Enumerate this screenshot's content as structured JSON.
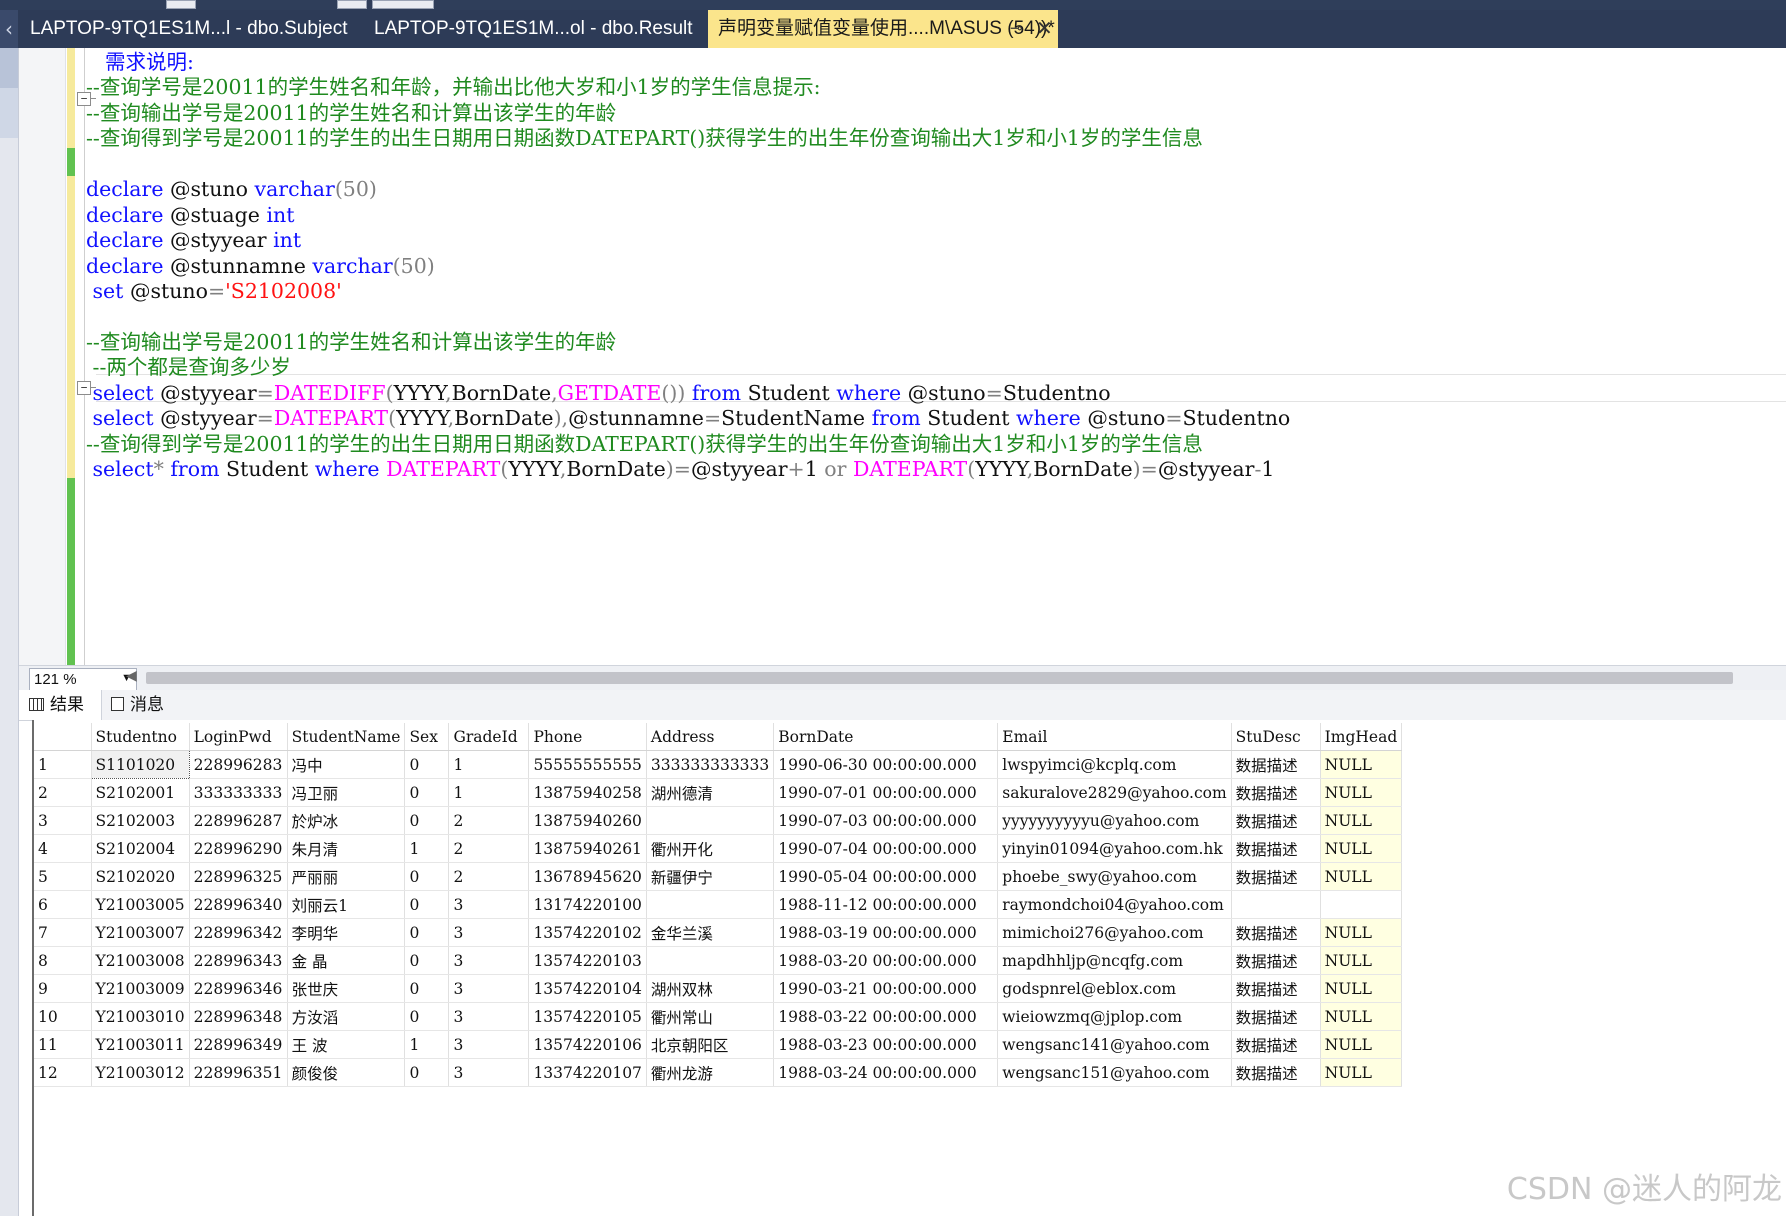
{
  "tabs": [
    {
      "label": "LAPTOP-9TQ1ES1M...l - dbo.Subject"
    },
    {
      "label": "LAPTOP-9TQ1ES1M...ol - dbo.Result"
    },
    {
      "label": "声明变量赋值变量使用....M\\ASUS (54))*",
      "active": true
    }
  ],
  "tab_icons": {
    "pin": "pin-icon",
    "close": "close-icon"
  },
  "editor": {
    "lines": {
      "l1": "需求说明:",
      "l2": "--查询学号是20011的学生姓名和年龄，并输出比他大岁和小1岁的学生信息提示:",
      "l3": "--查询输出学号是20011的学生姓名和计算出该学生的年龄",
      "l4": "--查询得到学号是20011的学生的出生日期用日期函数DATEPART()获得学生的出生年份查询输出大1岁和小1岁的学生信息",
      "l6a": "declare",
      "l6b": " @stuno ",
      "l6c": "varchar",
      "l6d": "(50)",
      "l7a": "declare",
      "l7b": " @stuage ",
      "l7c": "int",
      "l8a": "declare",
      "l8b": " @styyear ",
      "l8c": "int",
      "l9a": "declare",
      "l9b": " @stunnamne ",
      "l9c": "varchar",
      "l9d": "(50)",
      "l10a": " set",
      "l10b": " @stuno",
      "l10c": "=",
      "l10d": "'S2102008'",
      "l12": "--查询输出学号是20011的学生姓名和计算出该学生的年龄",
      "l13": " --两个都是查询多少岁",
      "l14a": " select",
      "l14b": " @styyear",
      "l14c": "=",
      "l14d": "DATEDIFF",
      "l14e": "(",
      "l14f": "YYYY",
      "l14g": ",",
      "l14h": "BornDate",
      "l14i": ",",
      "l14j": "GETDATE",
      "l14k": "())",
      "l14l": " from",
      "l14m": " Student ",
      "l14n": "where",
      "l14o": " @stuno",
      "l14p": "=",
      "l14q": "Studentno",
      "l15a": " select",
      "l15b": " @styyear",
      "l15c": "=",
      "l15d": "DATEPART",
      "l15e": "(",
      "l15f": "YYYY",
      "l15g": ",",
      "l15h": "BornDate",
      "l15i": "),",
      "l15j": "@stunnamne",
      "l15k": "=",
      "l15l": "StudentName ",
      "l15m": "from",
      "l15n": " Student ",
      "l15o": "where",
      "l15p": " @stuno",
      "l15q": "=",
      "l15r": "Studentno",
      "l16": "--查询得到学号是20011的学生的出生日期用日期函数DATEPART()获得学生的出生年份查询输出大1岁和小1岁的学生信息",
      "l17a": " select",
      "l17b": "*",
      "l17c": " from",
      "l17d": " Student ",
      "l17e": "where",
      "l17f": " DATEPART",
      "l17g": "(",
      "l17h": "YYYY",
      "l17i": ",",
      "l17j": "BornDate",
      "l17k": ")=",
      "l17l": "@styyear",
      "l17m": "+",
      "l17n": "1 ",
      "l17o": "or",
      "l17p": " DATEPART",
      "l17q": "(",
      "l17r": "YYYY",
      "l17s": ",",
      "l17t": "BornDate",
      "l17u": ")=",
      "l17v": "@styyear",
      "l17w": "-",
      "l17x": "1"
    }
  },
  "zoom": {
    "value": "121 %"
  },
  "results_tabs": [
    {
      "label": "结果"
    },
    {
      "label": "消息"
    }
  ],
  "grid": {
    "columns": [
      "Studentno",
      "LoginPwd",
      "StudentName",
      "Sex",
      "GradeId",
      "Phone",
      "Address",
      "BornDate",
      "Email",
      "StuDesc",
      "ImgHead"
    ],
    "rows": [
      [
        "1",
        "S1101020",
        "228996283",
        "冯中",
        "0",
        "1",
        "55555555555",
        "333333333333",
        "1990-06-30 00:00:00.000",
        "lwspyimci@kcplq.com",
        "数据描述",
        "NULL"
      ],
      [
        "2",
        "S2102001",
        "333333333",
        "冯卫丽",
        "0",
        "1",
        "13875940258",
        "湖州德清",
        "1990-07-01 00:00:00.000",
        "sakuralove2829@yahoo.com",
        "数据描述",
        "NULL"
      ],
      [
        "3",
        "S2102003",
        "228996287",
        "於炉冰",
        "0",
        "2",
        "13875940260",
        "",
        "1990-07-03 00:00:00.000",
        "yyyyyyyyyyu@yahoo.com",
        "数据描述",
        "NULL"
      ],
      [
        "4",
        "S2102004",
        "228996290",
        "朱月清",
        "1",
        "2",
        "13875940261",
        "衢州开化",
        "1990-07-04 00:00:00.000",
        "yinyin01094@yahoo.com.hk",
        "数据描述",
        "NULL"
      ],
      [
        "5",
        "S2102020",
        "228996325",
        "严丽丽",
        "0",
        "2",
        "13678945620",
        "新疆伊宁",
        "1990-05-04 00:00:00.000",
        "phoebe_swy@yahoo.com",
        "数据描述",
        "NULL"
      ],
      [
        "6",
        "Y21003005",
        "228996340",
        "刘丽云1",
        "0",
        "3",
        "13174220100",
        "",
        "1988-11-12 00:00:00.000",
        "raymondchoi04@yahoo.com",
        "",
        ""
      ],
      [
        "7",
        "Y21003007",
        "228996342",
        "李明华",
        "0",
        "3",
        "13574220102",
        "金华兰溪",
        "1988-03-19 00:00:00.000",
        "mimichoi276@yahoo.com",
        "数据描述",
        "NULL"
      ],
      [
        "8",
        "Y21003008",
        "228996343",
        " 金 晶",
        "0",
        "3",
        "13574220103",
        "",
        "1988-03-20 00:00:00.000",
        "mapdhhljp@ncqfg.com",
        "数据描述",
        "NULL"
      ],
      [
        "9",
        "Y21003009",
        "228996346",
        "张世庆",
        "0",
        "3",
        "13574220104",
        "湖州双林",
        "1990-03-21 00:00:00.000",
        "godspnrel@eblox.com",
        "数据描述",
        "NULL"
      ],
      [
        "10",
        "Y21003010",
        "228996348",
        "方汝滔",
        "0",
        "3",
        "13574220105",
        "衢州常山",
        "1988-03-22 00:00:00.000",
        "wieiowzmq@jplop.com",
        "数据描述",
        "NULL"
      ],
      [
        "11",
        "Y21003011",
        "228996349",
        "王 波",
        "1",
        "3",
        "13574220106",
        "北京朝阳区",
        "1988-03-23 00:00:00.000",
        "wengsanc141@yahoo.com",
        "数据描述",
        "NULL"
      ],
      [
        "12",
        "Y21003012",
        "228996351",
        "颜俊俊",
        "0",
        "3",
        "13374220107",
        "衢州龙游",
        "1988-03-24 00:00:00.000",
        "wengsanc151@yahoo.com",
        "数据描述",
        "NULL"
      ]
    ]
  },
  "watermark": "CSDN @迷人的阿龙",
  "colors": {
    "keyword": "#1111ff",
    "comment": "#1f8a1f",
    "function": "#ff00ff",
    "string": "#ff1111",
    "active_tab": "#fbe58c",
    "tab_bar": "#2d3b57"
  }
}
